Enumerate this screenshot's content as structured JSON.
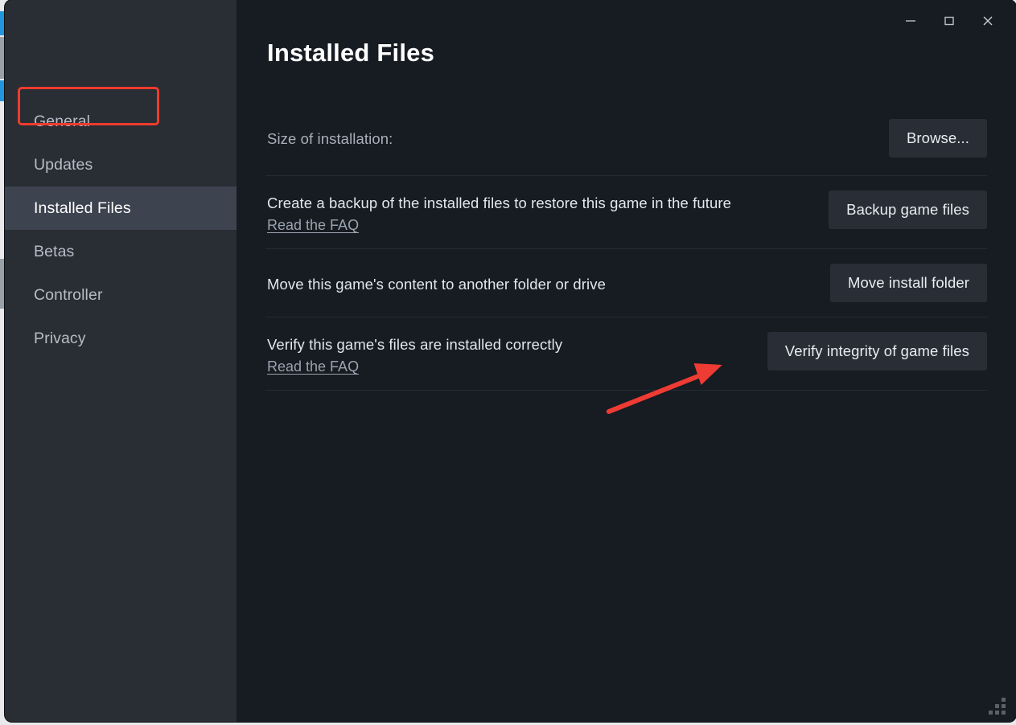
{
  "window": {
    "controls": [
      {
        "name": "minimize",
        "icon": "minimize-icon",
        "label": "Minimize"
      },
      {
        "name": "maximize",
        "icon": "maximize-icon",
        "label": "Maximize"
      },
      {
        "name": "close",
        "icon": "close-icon",
        "label": "Close"
      }
    ],
    "resize_grip_icon": "resize-grip-icon"
  },
  "sidebar": {
    "items": [
      {
        "label": "General",
        "selected": false
      },
      {
        "label": "Updates",
        "selected": false
      },
      {
        "label": "Installed Files",
        "selected": true
      },
      {
        "label": "Betas",
        "selected": false
      },
      {
        "label": "Controller",
        "selected": false
      },
      {
        "label": "Privacy",
        "selected": false
      }
    ]
  },
  "header": {
    "title": "Installed Files"
  },
  "rows": [
    {
      "description": "Size of installation:",
      "muted": true,
      "link": null,
      "button": "Browse..."
    },
    {
      "description": "Create a backup of the installed files to restore this game in the future",
      "muted": false,
      "link": "Read the FAQ",
      "button": "Backup game files"
    },
    {
      "description": "Move this game's content to another folder or drive",
      "muted": false,
      "link": null,
      "button": "Move install folder"
    },
    {
      "description": "Verify this game's files are installed correctly",
      "muted": false,
      "link": "Read the FAQ",
      "button": "Verify integrity of game files"
    }
  ],
  "annotations": {
    "highlight_color": "#ef3b2d",
    "arrow_color": "#ee3b34",
    "highlight_target": "Installed Files",
    "arrow_target": "Verify integrity of game files"
  },
  "colors": {
    "sidebar_bg": "#292d34",
    "content_bg": "#171b22",
    "selected_bg": "#3d444f",
    "button_bg": "#282d36",
    "text_primary": "#e4e7ea",
    "text_muted": "#a9b0ba"
  }
}
